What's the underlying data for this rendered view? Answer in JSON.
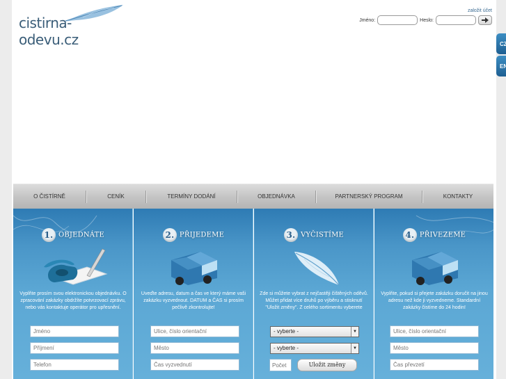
{
  "header": {
    "logo_text": "cistirna-odevu.cz",
    "register_link": "založit účet",
    "login": {
      "name_label": "Jméno:",
      "password_label": "Heslo:"
    }
  },
  "languages": [
    "CZ",
    "EN"
  ],
  "nav": {
    "items": [
      "O ČISTÍRNĚ",
      "CENÍK",
      "TERMÍNY DODÁNÍ",
      "OBJEDNÁVKA",
      "PARTNERSKÝ PROGRAM",
      "KONTAKTY"
    ]
  },
  "steps": [
    {
      "number": "1.",
      "title": "OBJEDNÁTE",
      "text": "Vyplňte prosím svou elektronickou objednávku. O zpracování zakázky obdržíte potvrzovací zprávu, nebo vás kontaktuje operátor pro upřesnění.",
      "fields": [
        "Jméno",
        "Příjmení",
        "Telefon"
      ]
    },
    {
      "number": "2.",
      "title": "PŘIJEDEME",
      "text": "Uveďte adresu, datum a čas ve který máme vaši zakázku vyzvednout. DATUM a ČAS si prosím pečlivě zkontrolujte!",
      "fields": [
        "Ulice, číslo orientační",
        "Město",
        "Čas vyzvednutí"
      ]
    },
    {
      "number": "3.",
      "title": "VYČISTÍME",
      "text": "Zde si můžete vybrat z nejčastěji čištěných oděvů. Můžet přidat více druhů po výběru a stisknutí \"Uložit změny\". Z celého sortimentu vyberete",
      "selects": [
        "- vyberte -",
        "- vyberte -"
      ],
      "count_placeholder": "Počet",
      "save_label": "Uložit změny"
    },
    {
      "number": "4.",
      "title": "PŘIVEZEME",
      "text": "Vyplňte, pokud si přejete zakázku doručit na jinou adresu než kde ji vyzvedneme. Standardní zakázky čistíme do 24 hodin!",
      "fields": [
        "Ulice, číslo orientační",
        "Město",
        "Čas převzetí"
      ]
    }
  ],
  "colors": {
    "panel_top": "#2e7bb4",
    "panel_bottom": "#66b0da",
    "nav": "#c3c3c3",
    "logo": "#3a5d78"
  },
  "icons": [
    "feather-icon",
    "phone-icon",
    "van-icon",
    "feather-icon",
    "van-icon",
    "arrow-right-icon"
  ]
}
